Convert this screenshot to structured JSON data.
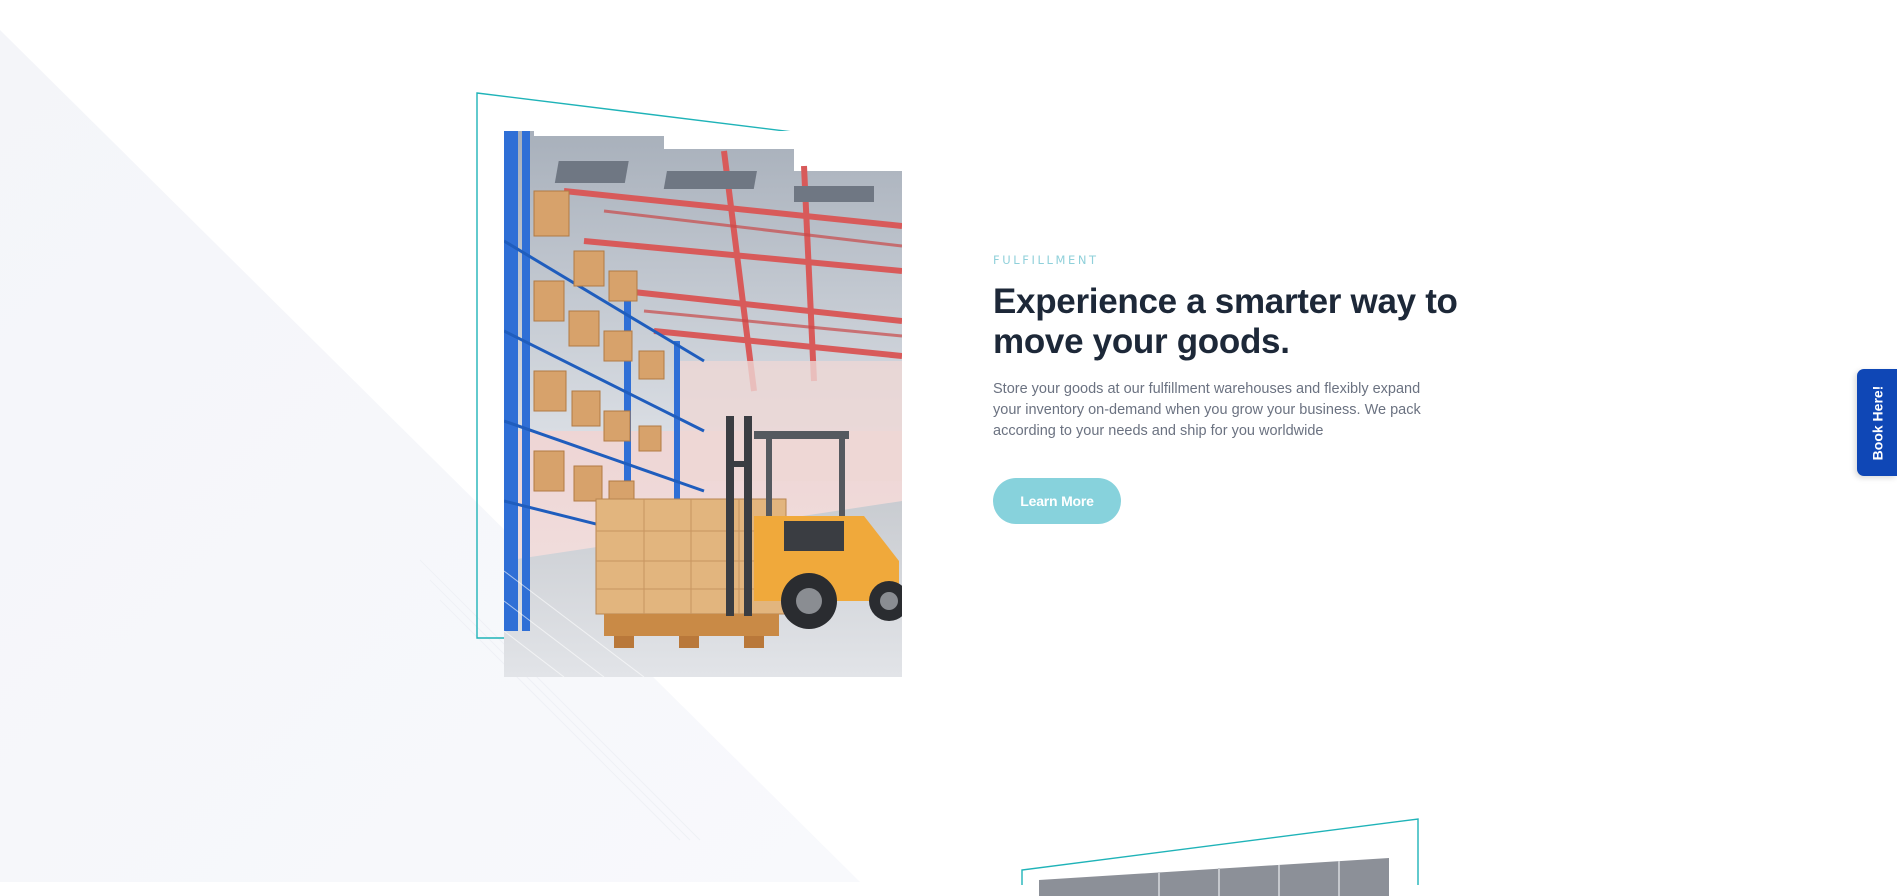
{
  "section": {
    "eyebrow": "FULFILLMENT",
    "headline": "Experience a smarter way to move your goods.",
    "description": "Store your goods at our fulfillment warehouses and flexibly expand your inventory on-demand when you grow your business. We pack according to your needs and ship for you worldwide",
    "cta_label": "Learn More"
  },
  "side_tab": {
    "label": "Book Here!"
  },
  "images": {
    "primary": "warehouse-forklift-image",
    "secondary": "warehouse-image-partial"
  },
  "colors": {
    "accent": "#87d2dc",
    "frame_outline": "#1fb3b8",
    "eyebrow": "#8fd0da",
    "headline": "#1d2838",
    "body_text": "#6b7281",
    "book_tab": "#0f47b6",
    "background_band": "#f7f8fb"
  }
}
